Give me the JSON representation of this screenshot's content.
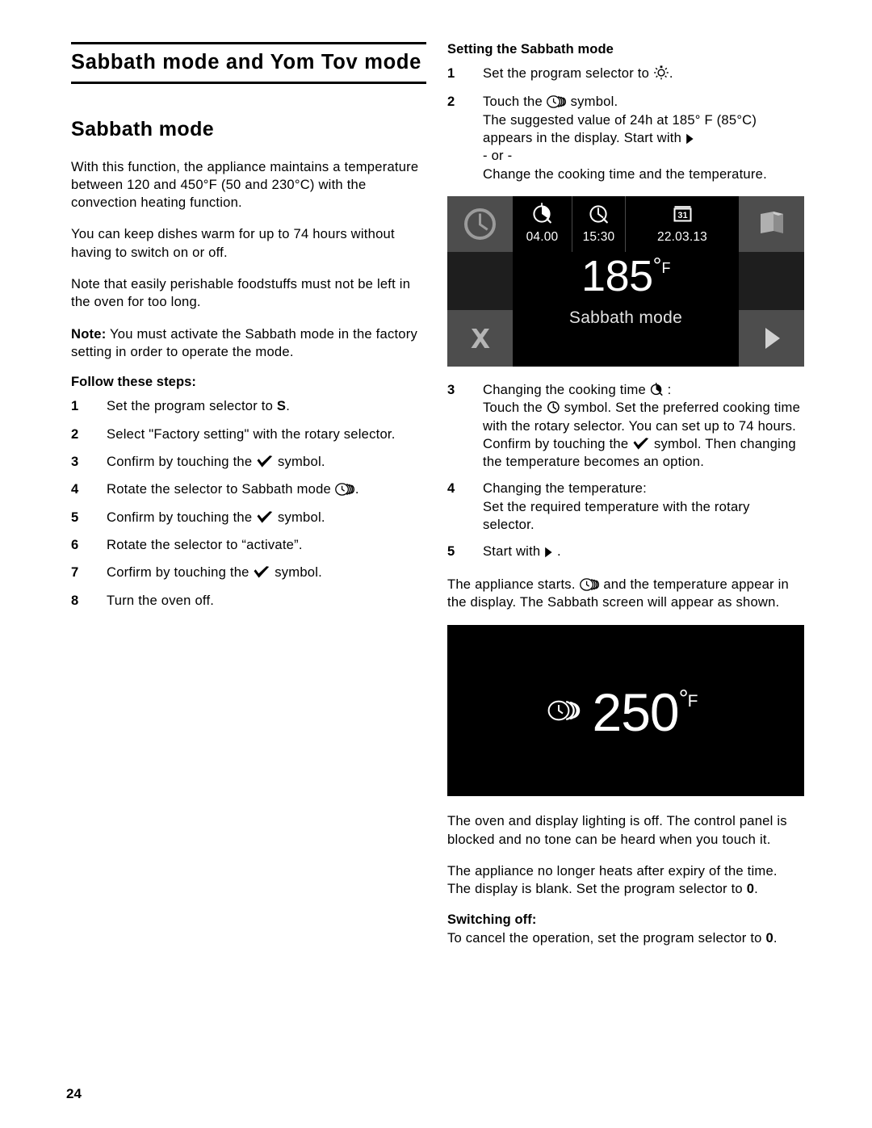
{
  "page": {
    "number": "24"
  },
  "left": {
    "chapter_title": "Sabbath mode and Yom Tov mode",
    "section_title": "Sabbath mode",
    "para1": "With this function, the appliance maintains a temperature between 120 and 450°F (50 and 230°C) with the convection heating function.",
    "para2": "You can keep dishes warm for up to 74 hours without having to switch on or off.",
    "para3": "Note that easily perishable foodstuffs must not be left in the oven for too long.",
    "note_label": "Note:",
    "note_text": " You must activate the Sabbath mode in the factory setting in order to operate the mode.",
    "steps_heading": "Follow these steps:",
    "steps": [
      {
        "num": "1",
        "pre": "Set the program selector to ",
        "bold": "S",
        "post": "."
      },
      {
        "num": "2",
        "pre": "Select \"Factory setting\" with the rotary selector.",
        "bold": "",
        "post": ""
      },
      {
        "num": "3",
        "pre": "Confirm by touching the ",
        "icon": "check-icon",
        "post": " symbol."
      },
      {
        "num": "4",
        "pre": "Rotate the selector to Sabbath mode ",
        "icon": "sabbath-mode-icon",
        "post": "."
      },
      {
        "num": "5",
        "pre": "Confirm by touching the ",
        "icon": "check-icon",
        "post": " symbol."
      },
      {
        "num": "6",
        "pre": "Rotate the selector to “activate”.",
        "icon": "",
        "post": ""
      },
      {
        "num": "7",
        "pre": "Corfirm by touching the ",
        "icon": "check-icon",
        "post": " symbol."
      },
      {
        "num": "8",
        "pre": "Turn the oven off.",
        "icon": "",
        "post": ""
      }
    ]
  },
  "right": {
    "heading": "Setting the Sabbath mode",
    "step1_pre": "Set the program selector to ",
    "step1_icon": "light-bulb-icon",
    "step1_post": ".",
    "step2_line1_pre": "Touch the ",
    "step2_line1_icon": "sabbath-mode-icon",
    "step2_line1_post": " symbol.",
    "step2_line2": "The suggested value of 24h at 185° F (85°C) appears in the display. Start with ",
    "step2_line2_icon": "play-icon",
    "step2_or": "- or -",
    "step2_line3": "Change the cooking time and the temperature.",
    "step3_title_pre": "Changing the cooking time ",
    "step3_title_icon": "cooking-time-icon",
    "step3_title_post": " :",
    "step3_body_pre": "Touch the ",
    "step3_body_icon": "clock-icon",
    "step3_body_mid": " symbol. Set the preferred cooking time with the rotary selector. You can set up to 74 hours. Confirm by touching the ",
    "step3_body_icon2": "check-icon",
    "step3_body_post": " symbol. Then changing the temperature becomes an option.",
    "step4_title": "Changing the temperature:",
    "step4_body": "Set the required temperature with the rotary selector.",
    "step5_pre": "Start with ",
    "step5_icon": "play-icon",
    "step5_post": " .",
    "para_start_pre": "The appliance starts. ",
    "para_start_icon": "sabbath-mode-icon",
    "para_start_post": " and the temperature appear in the display. The Sabbath screen will appear as shown.",
    "para_lighting": "The oven and display lighting is off. The control panel is blocked and no tone can be heard when you touch it.",
    "para_expiry_pre": "The appliance no longer heats after expiry of the time. The display is blank. Set the program selector to ",
    "para_expiry_bold": "0",
    "para_expiry_post": ".",
    "switching_off_heading": "Switching off:",
    "switching_off_pre": "To cancel the operation, set the program selector to ",
    "switching_off_bold": "0",
    "switching_off_post": "."
  },
  "display_185": {
    "timer_value": "04.00",
    "clock_value": "15:30",
    "date_value": "22.03.13",
    "temperature": "185",
    "degree": "°",
    "unit": "F",
    "mode_label": "Sabbath mode",
    "icons": {
      "left_clock": "clock-dial-icon",
      "timer": "cooking-time-icon",
      "clock": "clock-icon",
      "calendar": "calendar-icon",
      "book": "book-icon",
      "cancel": "close-x-icon",
      "start": "play-icon"
    },
    "colors": {
      "screen_bg": "#000000",
      "panel_gray": "#4d4d4d",
      "panel_dark": "#1e1e1e",
      "text": "#ffffff",
      "label_text": "#e2e2e2"
    }
  },
  "display_250": {
    "icon": "sabbath-mode-icon",
    "temperature": "250",
    "degree": "°",
    "unit": "F",
    "colors": {
      "screen_bg": "#000000",
      "text": "#ffffff"
    }
  }
}
